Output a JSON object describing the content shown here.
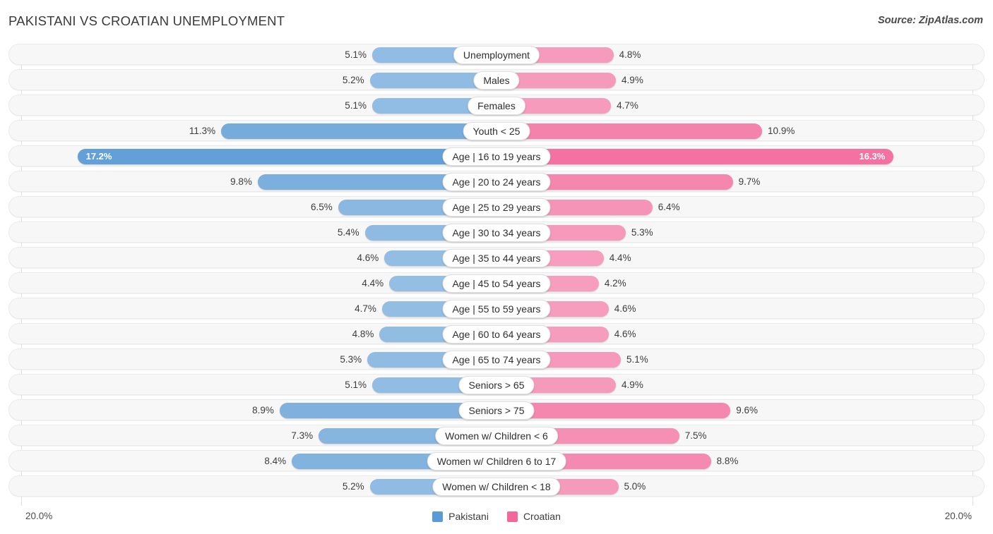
{
  "header": {
    "title": "PAKISTANI VS CROATIAN UNEMPLOYMENT",
    "source": "Source: ZipAtlas.com"
  },
  "footer": {
    "axis_left": "20.0%",
    "axis_right": "20.0%",
    "legend": [
      {
        "label": "Pakistani",
        "color": "#5b9bd5"
      },
      {
        "label": "Croatian",
        "color": "#f2689a"
      }
    ]
  },
  "chart_data": {
    "type": "bar",
    "title": "PAKISTANI VS CROATIAN UNEMPLOYMENT",
    "subtitle": "Source: ZipAtlas.com",
    "orientation": "horizontal-diverging",
    "xlabel": "",
    "ylabel": "",
    "axis_max": 20.0,
    "axis_unit": "%",
    "grid": true,
    "legend_position": "bottom-center",
    "categories": [
      "Unemployment",
      "Males",
      "Females",
      "Youth < 25",
      "Age | 16 to 19 years",
      "Age | 20 to 24 years",
      "Age | 25 to 29 years",
      "Age | 30 to 34 years",
      "Age | 35 to 44 years",
      "Age | 45 to 54 years",
      "Age | 55 to 59 years",
      "Age | 60 to 64 years",
      "Age | 65 to 74 years",
      "Seniors > 65",
      "Seniors > 75",
      "Women w/ Children < 6",
      "Women w/ Children 6 to 17",
      "Women w/ Children < 18"
    ],
    "series": [
      {
        "name": "Pakistani",
        "color": "#5b9bd5",
        "values": [
          5.1,
          5.2,
          5.1,
          11.3,
          17.2,
          9.8,
          6.5,
          5.4,
          4.6,
          4.4,
          4.7,
          4.8,
          5.3,
          5.1,
          8.9,
          7.3,
          8.4,
          5.2
        ],
        "labels": [
          "5.1%",
          "5.2%",
          "5.1%",
          "11.3%",
          "17.2%",
          "9.8%",
          "6.5%",
          "5.4%",
          "4.6%",
          "4.4%",
          "4.7%",
          "4.8%",
          "5.3%",
          "5.1%",
          "8.9%",
          "7.3%",
          "8.4%",
          "5.2%"
        ]
      },
      {
        "name": "Croatian",
        "color": "#f2689a",
        "values": [
          4.8,
          4.9,
          4.7,
          10.9,
          16.3,
          9.7,
          6.4,
          5.3,
          4.4,
          4.2,
          4.6,
          4.6,
          5.1,
          4.9,
          9.6,
          7.5,
          8.8,
          5.0
        ],
        "labels": [
          "4.8%",
          "4.9%",
          "4.7%",
          "10.9%",
          "16.3%",
          "9.7%",
          "6.4%",
          "5.3%",
          "4.4%",
          "4.2%",
          "4.6%",
          "4.6%",
          "5.1%",
          "4.9%",
          "9.6%",
          "7.5%",
          "8.8%",
          "5.0%"
        ]
      }
    ]
  }
}
